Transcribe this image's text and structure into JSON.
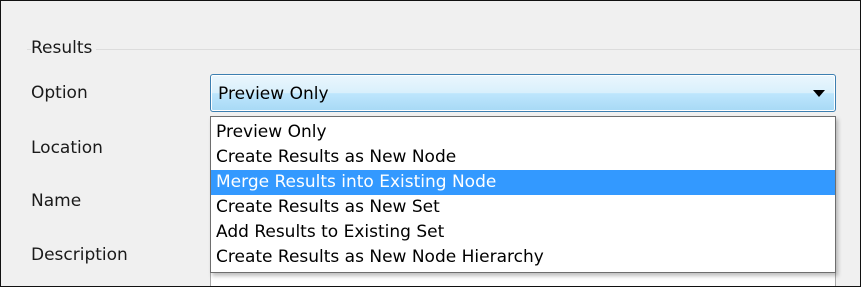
{
  "results_group": {
    "title": "Results"
  },
  "labels": {
    "option": "Option",
    "location": "Location",
    "name": "Name",
    "description": "Description"
  },
  "option_combo": {
    "selected_value": "Preview Only",
    "expanded": true,
    "items": [
      {
        "label": "Preview Only",
        "highlighted": false
      },
      {
        "label": "Create Results as New Node",
        "highlighted": false
      },
      {
        "label": "Merge Results into Existing Node",
        "highlighted": true
      },
      {
        "label": "Create Results as New Set",
        "highlighted": false
      },
      {
        "label": "Add Results to Existing Set",
        "highlighted": false
      },
      {
        "label": "Create Results as New Node Hierarchy",
        "highlighted": false
      }
    ]
  },
  "colors": {
    "highlight": "#3399ff",
    "combo_border": "#3c7fb1",
    "window_background": "#f0f0f0"
  }
}
